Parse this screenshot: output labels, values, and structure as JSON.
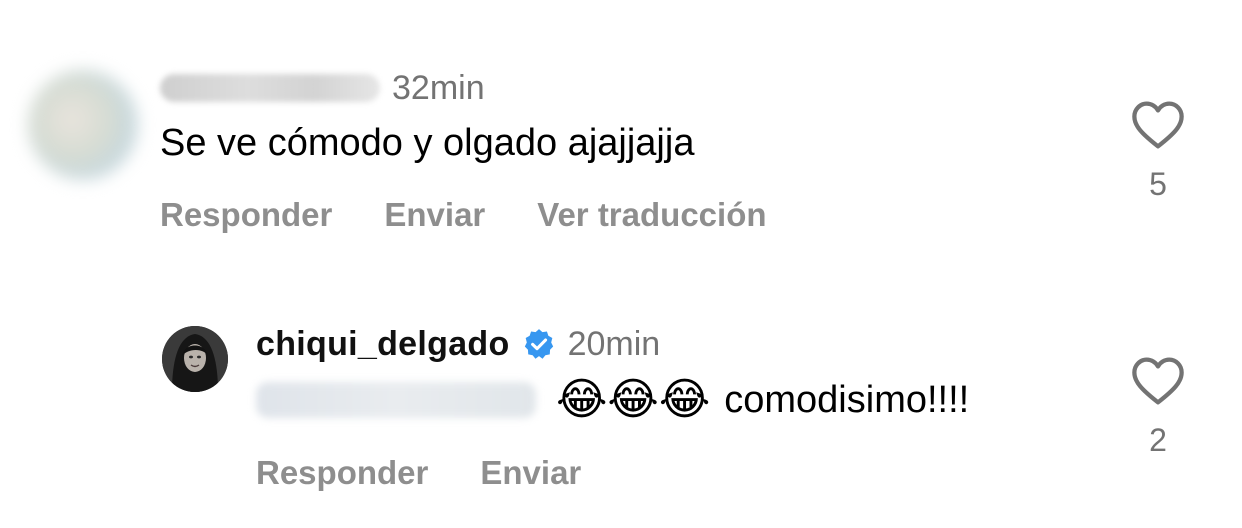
{
  "comments": [
    {
      "username": "",
      "time": "32min",
      "text": "Se ve cómodo y olgado ajajjajja",
      "actions": {
        "reply": "Responder",
        "send": "Enviar",
        "translate": "Ver traducción"
      },
      "likes": "5"
    },
    {
      "username": "chiqui_delgado",
      "verified": true,
      "time": "20min",
      "emojis": "😂😂😂",
      "text": "comodisimo!!!!",
      "actions": {
        "reply": "Responder",
        "send": "Enviar"
      },
      "likes": "2"
    }
  ],
  "colors": {
    "verified_blue": "#3797f0",
    "secondary_text": "#737373",
    "action_text": "#8e8e8e"
  }
}
